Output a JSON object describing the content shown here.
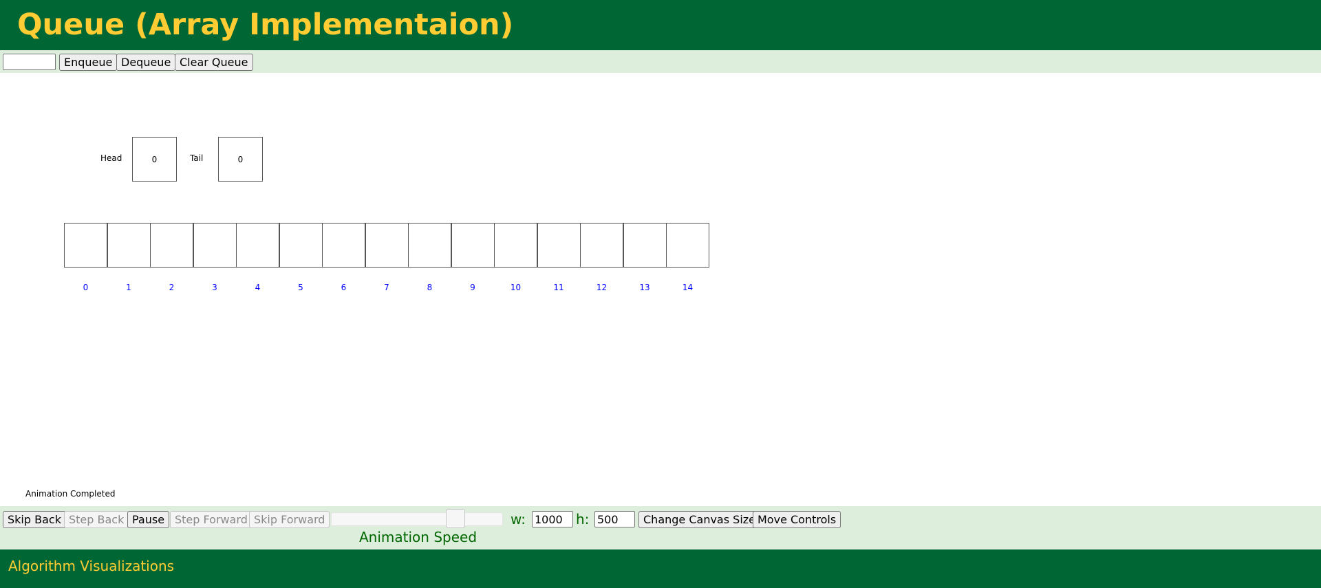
{
  "header": {
    "title": "Queue (Array Implementaion)"
  },
  "top_controls": {
    "input_value": "",
    "enqueue_label": "Enqueue",
    "dequeue_label": "Dequeue",
    "clear_label": "Clear Queue"
  },
  "canvas": {
    "head_label": "Head",
    "head_value": "0",
    "tail_label": "Tail",
    "tail_value": "0",
    "cells": [
      "",
      "",
      "",
      "",
      "",
      "",
      "",
      "",
      "",
      "",
      "",
      "",
      "",
      "",
      ""
    ],
    "indices": [
      "0",
      "1",
      "2",
      "3",
      "4",
      "5",
      "6",
      "7",
      "8",
      "9",
      "10",
      "11",
      "12",
      "13",
      "14"
    ],
    "status": "Animation Completed"
  },
  "bottom_controls": {
    "skip_back": "Skip Back",
    "step_back": "Step Back",
    "pause": "Pause",
    "step_forward": "Step Forward",
    "skip_forward": "Skip Forward",
    "speed_label": "Animation Speed",
    "speed_fraction": 0.75,
    "w_label": "w:",
    "w_value": "1000",
    "h_label": "h:",
    "h_value": "500",
    "change_canvas": "Change Canvas Size",
    "move_controls": "Move Controls"
  },
  "footer": {
    "text": "Algorithm Visualizations"
  },
  "colors": {
    "header_bg": "#006633",
    "title_text": "#ffcc33",
    "control_bar_bg": "#ddeedd",
    "index_text": "#0000ff",
    "green_label": "#006600"
  }
}
